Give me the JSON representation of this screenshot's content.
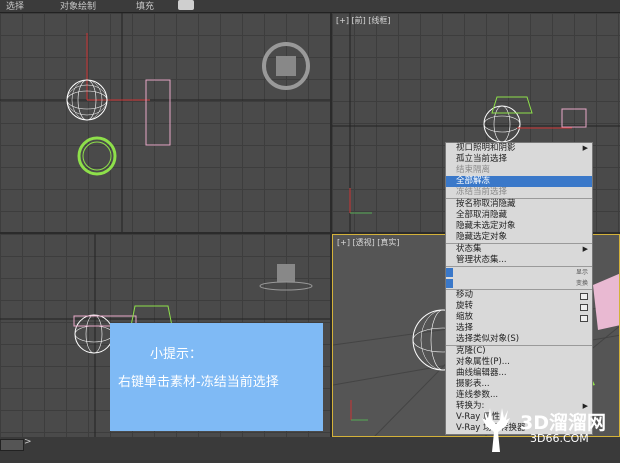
{
  "menubar": {
    "items": [
      "选择",
      "对象绘制",
      "填充"
    ]
  },
  "viewports": {
    "top_right_label": "[+] [前] [线框]",
    "bottom_right_label": "[+] [透视] [真实]"
  },
  "quad_menu": {
    "items": [
      {
        "label": "视口照明和阴影",
        "state": "normal",
        "submenu": true
      },
      {
        "label": "孤立当前选择",
        "state": "normal"
      },
      {
        "label": "结束隔离",
        "state": "disabled"
      },
      {
        "label": "全部解冻",
        "state": "selected"
      },
      {
        "label": "冻结当前选择",
        "state": "disabled"
      },
      {
        "label": "按名称取消隐藏",
        "state": "normal",
        "divider": true
      },
      {
        "label": "全部取消隐藏",
        "state": "normal"
      },
      {
        "label": "隐藏未选定对象",
        "state": "normal"
      },
      {
        "label": "隐藏选定对象",
        "state": "normal"
      },
      {
        "label": "状态集",
        "state": "normal",
        "submenu": true,
        "divider": true
      },
      {
        "label": "管理状态集...",
        "state": "normal"
      },
      {
        "label": "",
        "state": "normal",
        "bluebar": true,
        "hint": "显示",
        "divider": true
      },
      {
        "label": "",
        "state": "normal",
        "bluebar": true,
        "hint": "变换"
      },
      {
        "label": "移动",
        "state": "normal",
        "box": true,
        "divider": true
      },
      {
        "label": "旋转",
        "state": "normal",
        "box": true
      },
      {
        "label": "缩放",
        "state": "normal",
        "box": true
      },
      {
        "label": "选择",
        "state": "normal"
      },
      {
        "label": "选择类似对象(S)",
        "state": "normal"
      },
      {
        "label": "克隆(C)",
        "state": "normal",
        "divider": true
      },
      {
        "label": "对象属性(P)...",
        "state": "normal"
      },
      {
        "label": "曲线编辑器...",
        "state": "normal"
      },
      {
        "label": "摄影表...",
        "state": "normal"
      },
      {
        "label": "连线参数...",
        "state": "normal"
      },
      {
        "label": "转换为:",
        "state": "normal",
        "submenu": true
      },
      {
        "label": "V-Ray 属性",
        "state": "normal"
      },
      {
        "label": "V-Ray 场景转换器",
        "state": "normal"
      }
    ]
  },
  "tip": {
    "title": "小提示：",
    "body": "右键单击素材-冻结当前选择"
  },
  "watermark": {
    "brand": "3D溜溜网",
    "domain": "3D66.COM"
  },
  "colors": {
    "selected": "#3a78c9",
    "tip_bg": "#7fbaf5",
    "wire_white": "#ffffff",
    "wire_green": "#8ee04a"
  }
}
